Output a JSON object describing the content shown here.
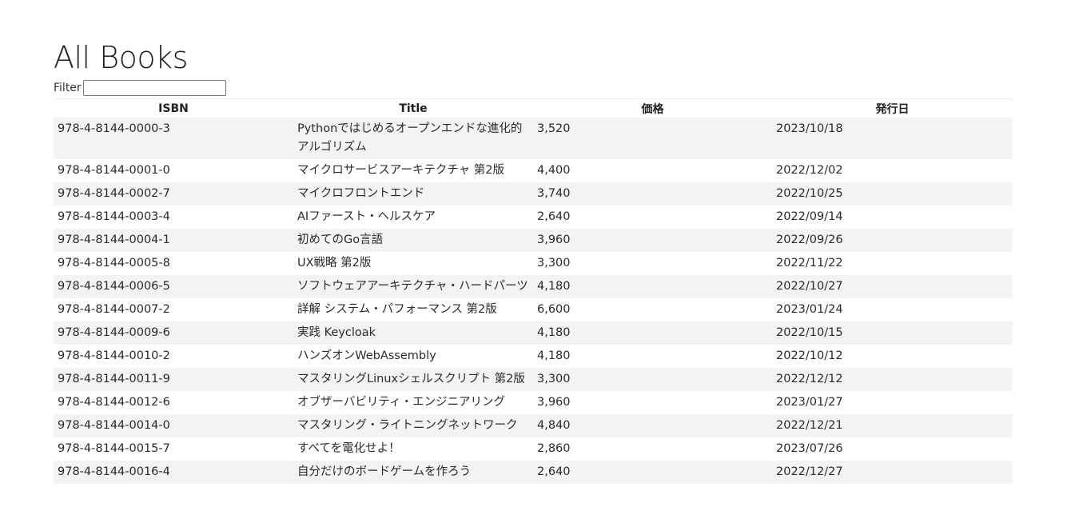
{
  "page": {
    "title": "All Books",
    "filter_label": "Filter",
    "filter_value": "",
    "filter_placeholder": ""
  },
  "table": {
    "headers": [
      "ISBN",
      "Title",
      "価格",
      "発行日"
    ],
    "rows": [
      {
        "isbn": "978-4-8144-0000-3",
        "title": "Pythonではじめるオープンエンドな進化的アルゴリズム",
        "price": "3,520",
        "date": "2023/10/18"
      },
      {
        "isbn": "978-4-8144-0001-0",
        "title": "マイクロサービスアーキテクチャ 第2版",
        "price": "4,400",
        "date": "2022/12/02"
      },
      {
        "isbn": "978-4-8144-0002-7",
        "title": "マイクロフロントエンド",
        "price": "3,740",
        "date": "2022/10/25"
      },
      {
        "isbn": "978-4-8144-0003-4",
        "title": "AIファースト・ヘルスケア",
        "price": "2,640",
        "date": "2022/09/14"
      },
      {
        "isbn": "978-4-8144-0004-1",
        "title": "初めてのGo言語",
        "price": "3,960",
        "date": "2022/09/26"
      },
      {
        "isbn": "978-4-8144-0005-8",
        "title": "UX戦略 第2版",
        "price": "3,300",
        "date": "2022/11/22"
      },
      {
        "isbn": "978-4-8144-0006-5",
        "title": "ソフトウェアアーキテクチャ・ハードパーツ",
        "price": "4,180",
        "date": "2022/10/27"
      },
      {
        "isbn": "978-4-8144-0007-2",
        "title": "詳解 システム・パフォーマンス 第2版",
        "price": "6,600",
        "date": "2023/01/24"
      },
      {
        "isbn": "978-4-8144-0009-6",
        "title": "実践 Keycloak",
        "price": "4,180",
        "date": "2022/10/15"
      },
      {
        "isbn": "978-4-8144-0010-2",
        "title": "ハンズオンWebAssembly",
        "price": "4,180",
        "date": "2022/10/12"
      },
      {
        "isbn": "978-4-8144-0011-9",
        "title": "マスタリングLinuxシェルスクリプト 第2版",
        "price": "3,300",
        "date": "2022/12/12"
      },
      {
        "isbn": "978-4-8144-0012-6",
        "title": "オブザーバビリティ・エンジニアリング",
        "price": "3,960",
        "date": "2023/01/27"
      },
      {
        "isbn": "978-4-8144-0014-0",
        "title": "マスタリング・ライトニングネットワーク",
        "price": "4,840",
        "date": "2022/12/21"
      },
      {
        "isbn": "978-4-8144-0015-7",
        "title": "すべてを電化せよ！",
        "price": "2,860",
        "date": "2023/07/26"
      },
      {
        "isbn": "978-4-8144-0016-4",
        "title": "自分だけのボードゲームを作ろう",
        "price": "2,640",
        "date": "2022/12/27"
      }
    ]
  }
}
